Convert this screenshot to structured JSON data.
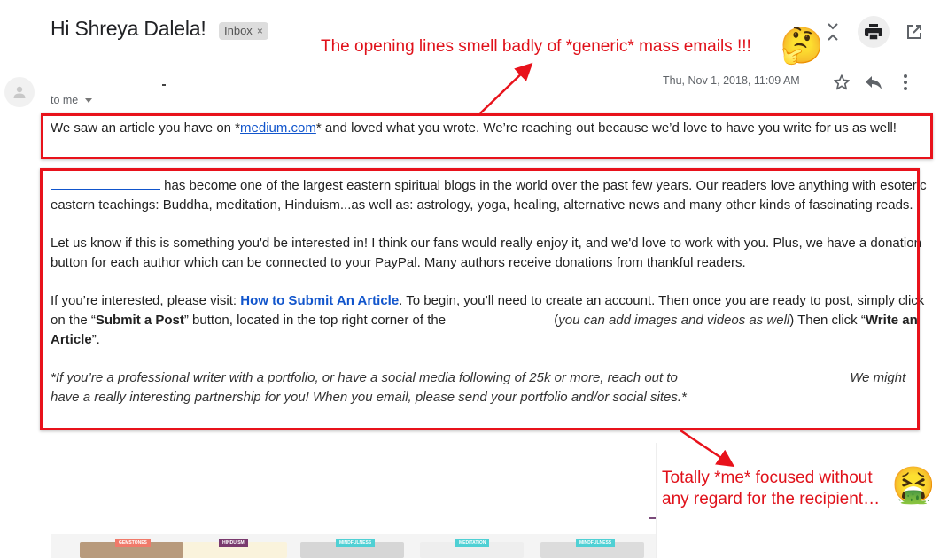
{
  "email": {
    "subject": "Hi Shreya Dalela!",
    "label": "Inbox",
    "label_remove_glyph": "×",
    "recipient_line": "to me",
    "date": "Thu, Nov 1, 2018, 11:09 AM",
    "top_icons": [
      "expand-collapse-icon",
      "print-icon",
      "open-in-new-window-icon"
    ],
    "message_actions": [
      "star-icon",
      "reply-icon",
      "more-vert-icon"
    ]
  },
  "body": {
    "p1_before": "We saw an article you have on *",
    "p1_link": "medium.com",
    "p1_after": "* and loved what you wrote. We’re reaching out because we’d love to have you write for us as well!",
    "p2_after": " has become one of the largest eastern spiritual blogs in the world over the past few years. Our readers love anything with esoteric eastern teachings: Buddha, meditation, Hinduism...as well as: astrology, yoga, healing, alternative news and many other kinds of fascinating reads.",
    "p3": "Let us know if this is something you'd be interested in! I think our fans would really enjoy it, and we'd love to work with you. Plus, we have a donation button for each author which can be connected to your PayPal. Many authors receive donations from thankful readers.",
    "p4_a": "If you’re interested, please visit: ",
    "p4_link": "How to Submit An Article",
    "p4_b": ". To begin, you’ll need to create an account. Then once you are ready to post, simply click on the “",
    "p4_bold1": "Submit a Post",
    "p4_c": "” button, located in the top right corner of the ",
    "p4_italic_open": "(",
    "p4_italic": "you can add images and videos as well",
    "p4_italic_close": ")",
    "p4_d": " Then click “",
    "p4_bold2": "Write an Article",
    "p4_e": "”.",
    "p5_a": "*If you’re a professional writer with a portfolio, or have a social media following of 25k or more, reach out to ",
    "p5_b": " We might have a really interesting partnership for you! When you email, please send your portfolio and/or social sites.*"
  },
  "annotations": {
    "top": "The opening lines smell badly of *generic* mass emails !!!",
    "top_emoji": "🤔",
    "bottom": "Totally *me* focused without any regard for the recipient…",
    "bottom_emoji": "🤮",
    "color": "#e8121b"
  },
  "thumbnails": [
    {
      "tag": "GEMSTONES",
      "tag_color": "#f07a6a",
      "bg": "#b89a7c"
    },
    {
      "tag": "HINDUISM",
      "tag_color": "#7a3a6e",
      "bg": "#faf3dc"
    },
    {
      "tag": "MINDFULNESS",
      "tag_color": "#4fd0d4",
      "bg": "#d6d6d6"
    },
    {
      "tag": "MEDITATION",
      "tag_color": "#4fd0d4",
      "bg": "#eeeeee"
    },
    {
      "tag": "MINDFULNESS",
      "tag_color": "#4fd0d4",
      "bg": "#dcdcdc"
    }
  ]
}
